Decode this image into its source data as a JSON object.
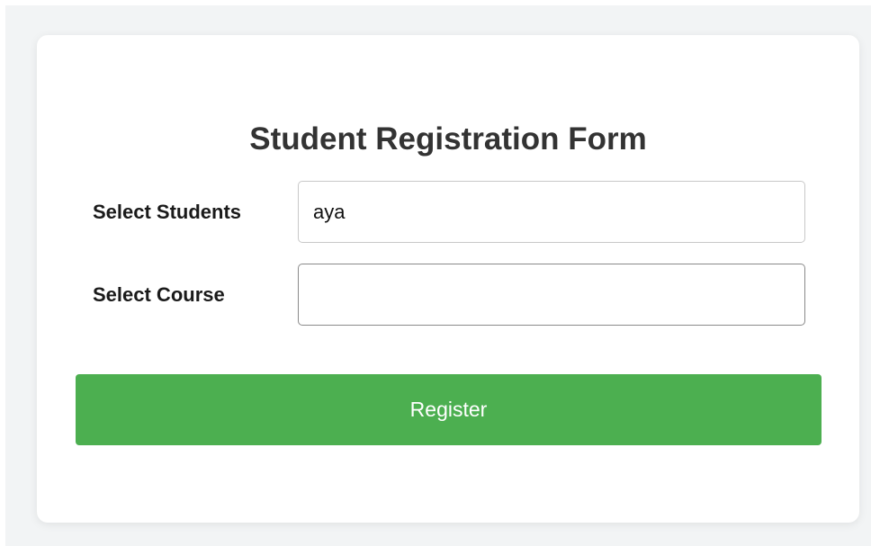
{
  "form": {
    "title": "Student Registration Form",
    "students_label": "Select Students",
    "students_value": "aya",
    "course_label": "Select Course",
    "course_value": "",
    "register_label": "Register"
  },
  "colors": {
    "page_background": "#f2f4f5",
    "card_background": "#ffffff",
    "button_background": "#4caf50",
    "button_text": "#ffffff"
  }
}
